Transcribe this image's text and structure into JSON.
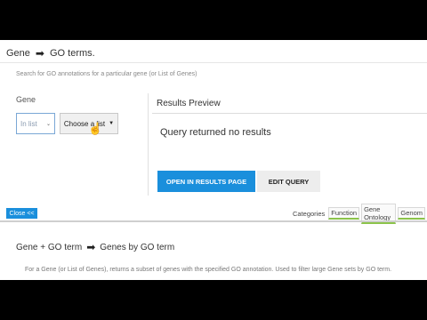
{
  "header": {
    "title_left": "Gene",
    "title_right": "GO terms.",
    "description": "Search for GO annotations for a particular gene (or List of Genes)"
  },
  "form": {
    "gene_label": "Gene",
    "select_value": "In list",
    "choose_list_label": "Choose a list"
  },
  "results": {
    "title": "Results Preview",
    "message": "Query returned no results"
  },
  "actions": {
    "open_label": "OPEN IN RESULTS PAGE",
    "edit_label": "EDIT QUERY"
  },
  "footer": {
    "close_label": "Close <<",
    "categories_label": "Categories",
    "tabs": [
      "Function",
      "Gene Ontology",
      "Genom"
    ]
  },
  "next_section": {
    "title_left": "Gene + GO term",
    "title_right": "Genes by GO term",
    "description": "For a Gene (or List of Genes), returns a subset of genes with the specified GO annotation. Used to filter large Gene sets by GO term."
  },
  "colors": {
    "accent": "#1a8fdc",
    "tab_underline": "#8bc34a"
  }
}
